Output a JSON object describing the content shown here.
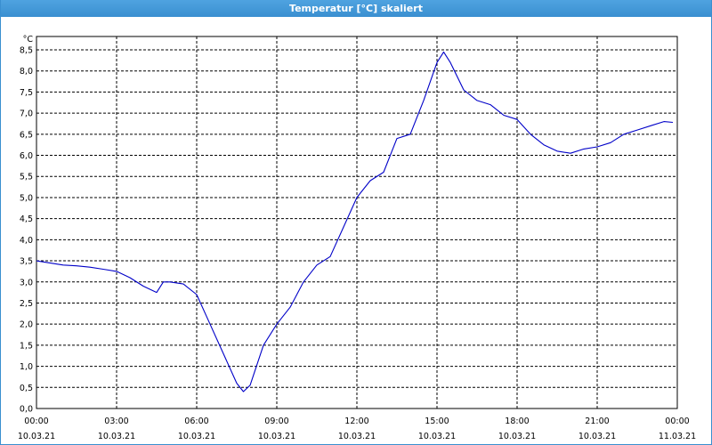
{
  "window": {
    "title": "Temperatur [°C] skaliert"
  },
  "colors": {
    "line": "#0000c8",
    "grid": "#000000",
    "title_bar": "#3a8fd0"
  },
  "chart_data": {
    "type": "line",
    "title": "Temperatur [°C] skaliert",
    "ylabel": "°C",
    "xlabel": "",
    "ylim": [
      0,
      8.5
    ],
    "xlim_hours": [
      0,
      24
    ],
    "grid": true,
    "y_ticks": [
      "0,0",
      "0,5",
      "1,0",
      "1,5",
      "2,0",
      "2,5",
      "3,0",
      "3,5",
      "4,0",
      "4,5",
      "5,0",
      "5,5",
      "6,0",
      "6,5",
      "7,0",
      "7,5",
      "8,0",
      "8,5"
    ],
    "x_ticks": [
      {
        "time": "00:00",
        "date": "10.03.21"
      },
      {
        "time": "03:00",
        "date": "10.03.21"
      },
      {
        "time": "06:00",
        "date": "10.03.21"
      },
      {
        "time": "09:00",
        "date": "10.03.21"
      },
      {
        "time": "12:00",
        "date": "10.03.21"
      },
      {
        "time": "15:00",
        "date": "10.03.21"
      },
      {
        "time": "18:00",
        "date": "10.03.21"
      },
      {
        "time": "21:00",
        "date": "10.03.21"
      },
      {
        "time": "00:00",
        "date": "11.03.21"
      }
    ],
    "series": [
      {
        "x": [
          "00:00",
          "00:30",
          "01:00",
          "01:30",
          "02:00",
          "02:30",
          "03:00",
          "03:30",
          "04:00",
          "04:30",
          "04:45",
          "05:00",
          "05:30",
          "06:00",
          "06:30",
          "07:00",
          "07:30",
          "07:45",
          "08:00",
          "08:30",
          "09:00",
          "09:30",
          "10:00",
          "10:30",
          "11:00",
          "11:30",
          "12:00",
          "12:30",
          "13:00",
          "13:30",
          "14:00",
          "14:30",
          "15:00",
          "15:15",
          "15:30",
          "16:00",
          "16:30",
          "17:00",
          "17:30",
          "18:00",
          "18:30",
          "19:00",
          "19:30",
          "20:00",
          "20:30",
          "21:00",
          "21:30",
          "22:00",
          "22:30",
          "23:00",
          "23:30",
          "23:50"
        ],
        "values": [
          3.5,
          3.45,
          3.4,
          3.38,
          3.35,
          3.3,
          3.25,
          3.1,
          2.9,
          2.75,
          3.0,
          3.0,
          2.95,
          2.7,
          2.0,
          1.3,
          0.6,
          0.4,
          0.55,
          1.5,
          2.0,
          2.4,
          3.0,
          3.4,
          3.6,
          4.3,
          5.0,
          5.4,
          5.6,
          6.4,
          6.5,
          7.3,
          8.2,
          8.45,
          8.2,
          7.55,
          7.3,
          7.2,
          6.95,
          6.85,
          6.5,
          6.25,
          6.1,
          6.05,
          6.15,
          6.2,
          6.3,
          6.5,
          6.6,
          6.7,
          6.8,
          6.78
        ]
      }
    ]
  }
}
